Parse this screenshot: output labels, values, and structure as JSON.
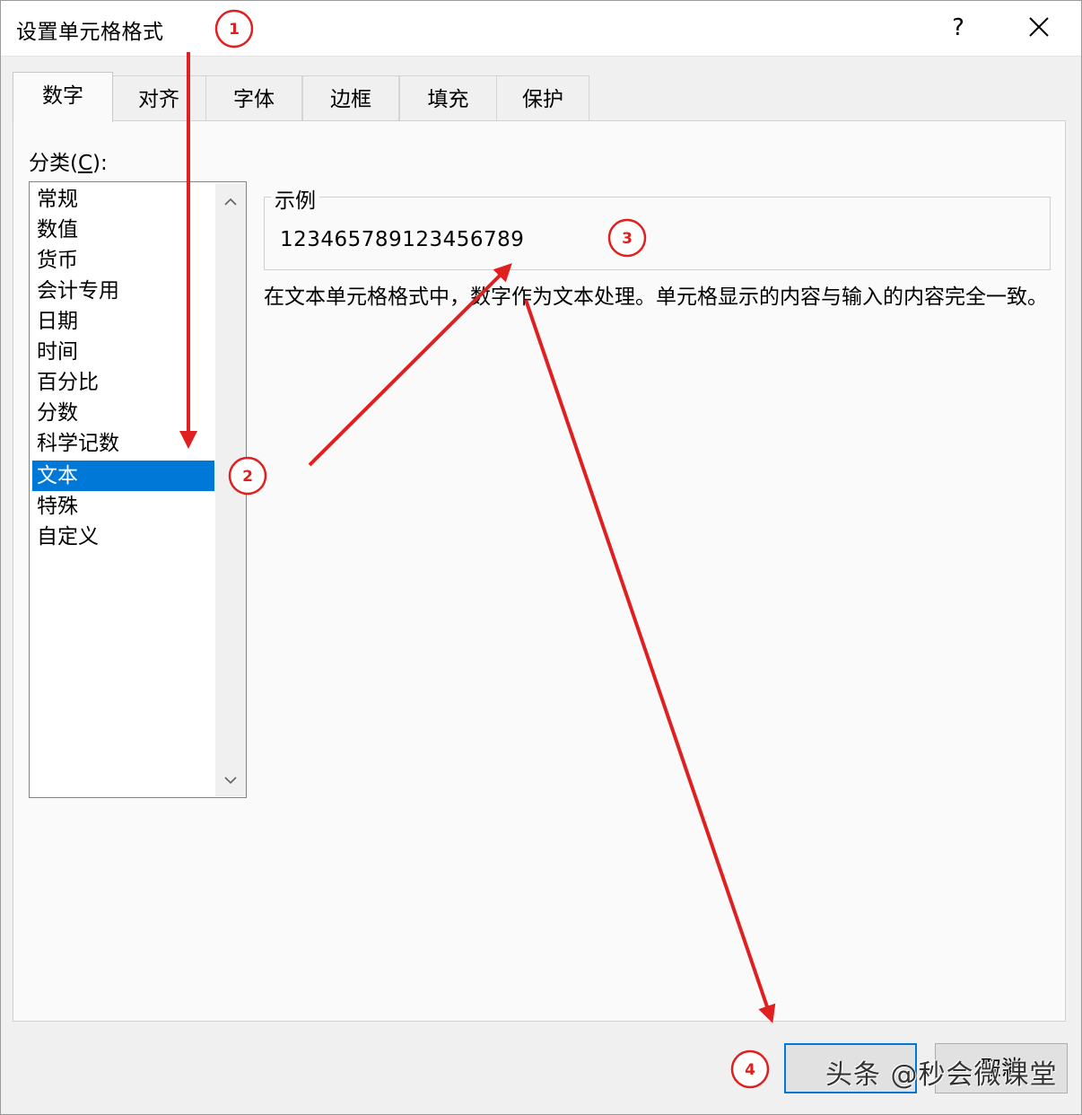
{
  "window": {
    "title": "设置单元格格式",
    "help_label": "?"
  },
  "tabs": [
    {
      "label": "数字",
      "active": true
    },
    {
      "label": "对齐"
    },
    {
      "label": "字体"
    },
    {
      "label": "边框"
    },
    {
      "label": "填充"
    },
    {
      "label": "保护"
    }
  ],
  "category": {
    "label_prefix": "分类(",
    "label_key": "C",
    "label_suffix": "):",
    "items": [
      "常规",
      "数值",
      "货币",
      "会计专用",
      "日期",
      "时间",
      "百分比",
      "分数",
      "科学记数",
      "文本",
      "特殊",
      "自定义"
    ],
    "selected": "文本"
  },
  "sample": {
    "legend": "示例",
    "value": "123465789123456789"
  },
  "description": "在文本单元格格式中，数字作为文本处理。单元格显示的内容与输入的内容完全一致。",
  "buttons": {
    "ok_label": "",
    "cancel_label": "取消"
  },
  "watermark": "头条 @秒会微课堂",
  "annotations": {
    "color": "#e02020",
    "markers": [
      "1",
      "2",
      "3",
      "4"
    ]
  },
  "colors": {
    "selection": "#0078d7",
    "panel": "#fafafa",
    "background": "#f0f0f0"
  }
}
